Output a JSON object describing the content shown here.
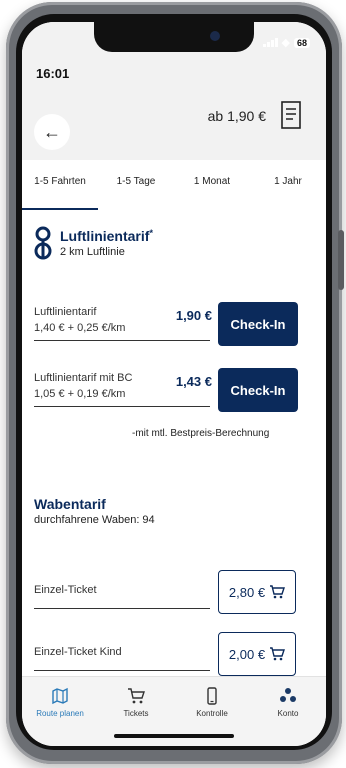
{
  "status_bar": {
    "time": "16:01",
    "battery": "68"
  },
  "header": {
    "back_label": "←",
    "price_from": "ab 1,90 €"
  },
  "tabs": [
    {
      "label": "1-5 Fahrten",
      "active": true
    },
    {
      "label": "1-5 Tage",
      "active": false
    },
    {
      "label": "1 Monat",
      "active": false
    },
    {
      "label": "1 Jahr",
      "active": false
    }
  ],
  "luftlinie": {
    "title": "Luftlinientarif",
    "title_mark": "*",
    "subtitle": "2 km Luftlinie"
  },
  "fares": [
    {
      "name": "Luftlinientarif",
      "detail": "1,40 € + 0,25 €/km",
      "price": "1,90 €",
      "button": "Check-In"
    },
    {
      "name": "Luftlinientarif mit BC",
      "detail": "1,05 € + 0,19 €/km",
      "price": "1,43 €",
      "button": "Check-In"
    }
  ],
  "bestpreis_note": "-mit mtl. Bestpreis-Berechnung",
  "wabentarif": {
    "title": "Wabentarif",
    "subtitle": "durchfahrene Waben: 94"
  },
  "tickets": [
    {
      "name": "Einzel-Ticket",
      "price": "2,80 €"
    },
    {
      "name": "Einzel-Ticket Kind",
      "price": "2,00 €"
    }
  ],
  "bottom_nav": [
    {
      "label": "Route planen",
      "icon": "map-icon",
      "active": true
    },
    {
      "label": "Tickets",
      "icon": "cart-icon",
      "active": false
    },
    {
      "label": "Kontrolle",
      "icon": "phone-icon",
      "active": false
    },
    {
      "label": "Konto",
      "icon": "account-icon",
      "active": false
    }
  ],
  "colors": {
    "primary": "#0b2a5b",
    "accent": "#2a7ab8"
  }
}
